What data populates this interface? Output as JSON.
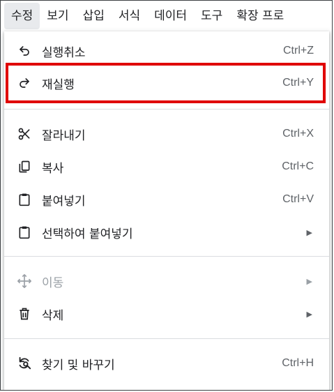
{
  "menubar": {
    "items": [
      "수정",
      "보기",
      "삽입",
      "서식",
      "데이터",
      "도구",
      "확장 프로"
    ]
  },
  "edit_menu": {
    "items": [
      {
        "label": "실행취소",
        "shortcut": "Ctrl+Z",
        "icon": "undo-icon"
      },
      {
        "label": "재실행",
        "shortcut": "Ctrl+Y",
        "icon": "redo-icon",
        "highlighted": true
      },
      {
        "label": "잘라내기",
        "shortcut": "Ctrl+X",
        "icon": "scissors-icon"
      },
      {
        "label": "복사",
        "shortcut": "Ctrl+C",
        "icon": "copy-icon"
      },
      {
        "label": "붙여넣기",
        "shortcut": "Ctrl+V",
        "icon": "clipboard-icon"
      },
      {
        "label": "선택하여 붙여넣기",
        "submenu": true,
        "icon": "clipboard-icon"
      },
      {
        "label": "이동",
        "submenu": true,
        "disabled": true,
        "icon": "move-icon"
      },
      {
        "label": "삭제",
        "submenu": true,
        "icon": "trash-icon"
      },
      {
        "label": "찾기 및 바꾸기",
        "shortcut": "Ctrl+H",
        "icon": "find-replace-icon"
      }
    ]
  },
  "colors": {
    "highlight_border": "#e00000",
    "text": "#202124",
    "muted": "#5f6368",
    "disabled": "#9aa0a6"
  }
}
